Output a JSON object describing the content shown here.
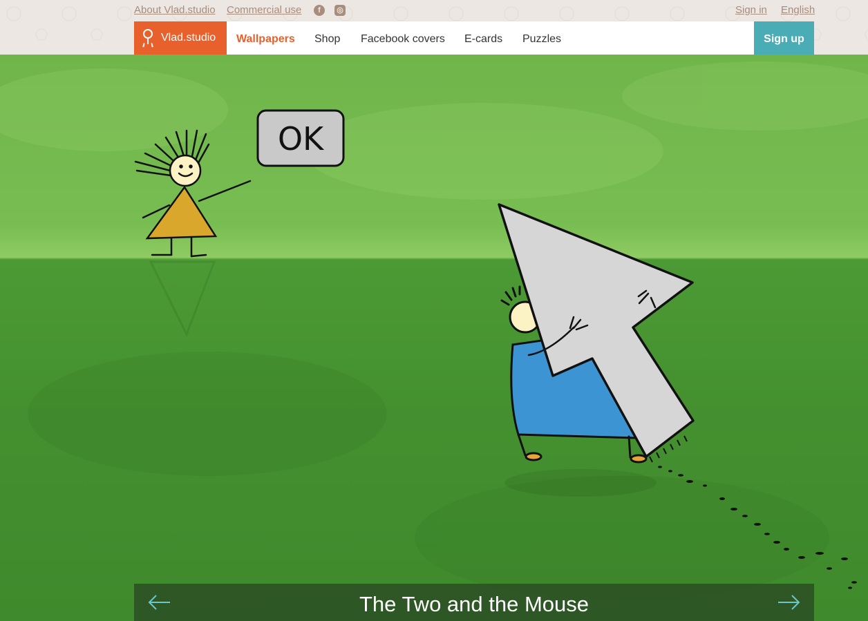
{
  "top_links": {
    "about": "About Vlad.studio",
    "commercial": "Commercial use",
    "facebook_icon": "facebook-icon",
    "instagram_icon": "instagram-icon",
    "sign_in": "Sign in",
    "language": "English"
  },
  "nav": {
    "brand": "Vlad.studio",
    "items": [
      {
        "label": "Wallpapers",
        "active": true
      },
      {
        "label": "Shop"
      },
      {
        "label": "Facebook covers"
      },
      {
        "label": "E-cards"
      },
      {
        "label": "Puzzles"
      }
    ],
    "signup": "Sign up"
  },
  "wallpaper": {
    "speech_bubble": "OK",
    "title": "The Two and the Mouse",
    "prev_icon": "arrow-left-icon",
    "next_icon": "arrow-right-icon"
  },
  "colors": {
    "accent": "#e8612c",
    "signup": "#4aacb4",
    "link": "#a88c7c",
    "arrow": "#6ec6c8"
  }
}
